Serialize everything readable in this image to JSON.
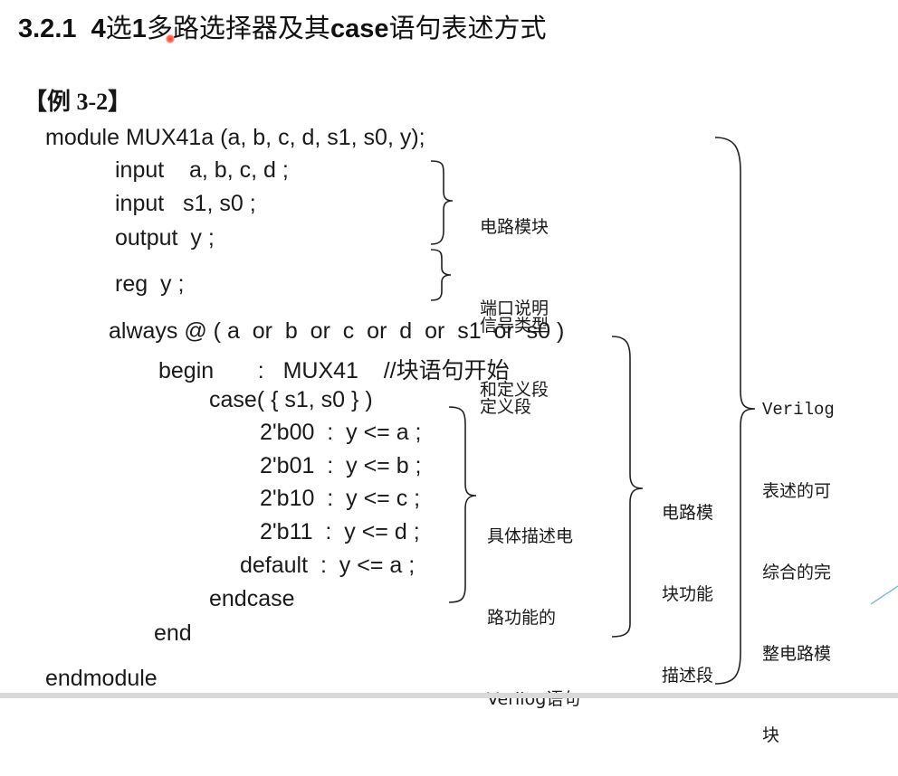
{
  "title": {
    "number": "3.2.1",
    "prefix_bold": "4",
    "prefix_rest": "选",
    "one_bold": "1",
    "middle": "多路选择器及其",
    "keyword_bold": "case",
    "suffix": "语句表述方式"
  },
  "example_label": "【例 3-2】",
  "code": {
    "module_line": "module MUX41a (a, b, c, d, s1, s0, y);",
    "input_abcd": "input    a, b, c, d ;",
    "input_s": "input   s1, s0 ;",
    "output_y": "output  y ;",
    "reg_y": "reg  y ;",
    "always_line": "always @ ( a  or  b  or  c  or  d  or  s1  or  s0 )",
    "begin_line": "begin       :   MUX41    //块语句开始",
    "case_line": "case( { s1, s0 } )",
    "case_00": "2'b00  :  y <= a ;",
    "case_01": "2'b01  :  y <= b ;",
    "case_10": "2'b10  :  y <= c ;",
    "case_11": "2'b11  :  y <= d ;",
    "default_line": "default  :  y <= a ;",
    "endcase_line": "endcase",
    "end_line": "end",
    "endmodule_line": "endmodule"
  },
  "annotations": {
    "port_section": [
      "电路模块",
      "端口说明",
      "和定义段"
    ],
    "signal_type": [
      "信号类型",
      "定义段"
    ],
    "verilog_statements": [
      "具体描述电",
      "路功能的",
      "Verilog语句"
    ],
    "function_section": [
      "电路模",
      "块功能",
      "描述段"
    ],
    "complete_module": [
      "Verilog",
      "表述的可",
      "综合的完",
      "整电路模",
      "块"
    ]
  }
}
